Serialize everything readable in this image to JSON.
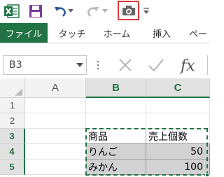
{
  "quick_access": {
    "icons": [
      "excel-logo-icon",
      "save-icon",
      "undo-icon",
      "undo-dropdown-icon",
      "redo-icon",
      "redo-dropdown-icon",
      "camera-icon",
      "customize-qat-icon"
    ],
    "colors": {
      "excel_green": "#217346",
      "camera_highlight": "#e03a3a"
    }
  },
  "ribbon_tabs": [
    {
      "label": "ファイル",
      "active": true
    },
    {
      "label": "タッチ"
    },
    {
      "label": "ホーム"
    },
    {
      "label": "挿入"
    },
    {
      "label": "ペー"
    }
  ],
  "formula_bar": {
    "name_box": "B3",
    "icons": [
      "name-box-dropdown-icon",
      "more-icon",
      "cancel-icon",
      "enter-icon",
      "insert-function-icon"
    ]
  },
  "columns": [
    "A",
    "B",
    "C"
  ],
  "rows": [
    "1",
    "2",
    "3",
    "4",
    "5"
  ],
  "table": {
    "header": [
      "商品",
      "売上個数"
    ],
    "rows": [
      [
        "りんご",
        "50"
      ],
      [
        "みかん",
        "100"
      ]
    ]
  }
}
